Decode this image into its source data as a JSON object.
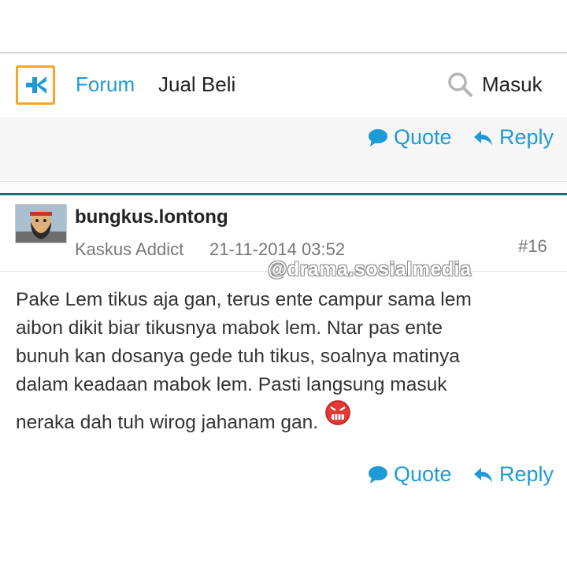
{
  "header": {
    "nav": {
      "forum": "Forum",
      "jual_beli": "Jual Beli"
    },
    "login": "Masuk",
    "logo_icon": "kaskus-logo-icon",
    "search_icon": "search-icon"
  },
  "colors": {
    "accent": "#1e9ad6",
    "logo_border": "#f5a623",
    "divider": "#1a6b72",
    "muted": "#777777"
  },
  "actions_top": {
    "quote": "Quote",
    "reply": "Reply"
  },
  "post": {
    "username": "bungkus.lontong",
    "rank": "Kaskus Addict",
    "date": "21-11-2014 03:52",
    "number": "#16",
    "body_lines": [
      "Pake Lem tikus aja gan, terus ente campur sama lem",
      "aibon dikit biar tikusnya mabok lem. Ntar pas ente",
      "bunuh kan dosanya gede tuh tikus, soalnya matinya",
      "dalam keadaan mabok lem. Pasti langsung masuk",
      "neraka dah tuh wirog jahanam gan."
    ],
    "emoji": "angry-face-icon",
    "actions": {
      "quote": "Quote",
      "reply": "Reply"
    }
  },
  "watermark": "@drama.sosialmedia"
}
